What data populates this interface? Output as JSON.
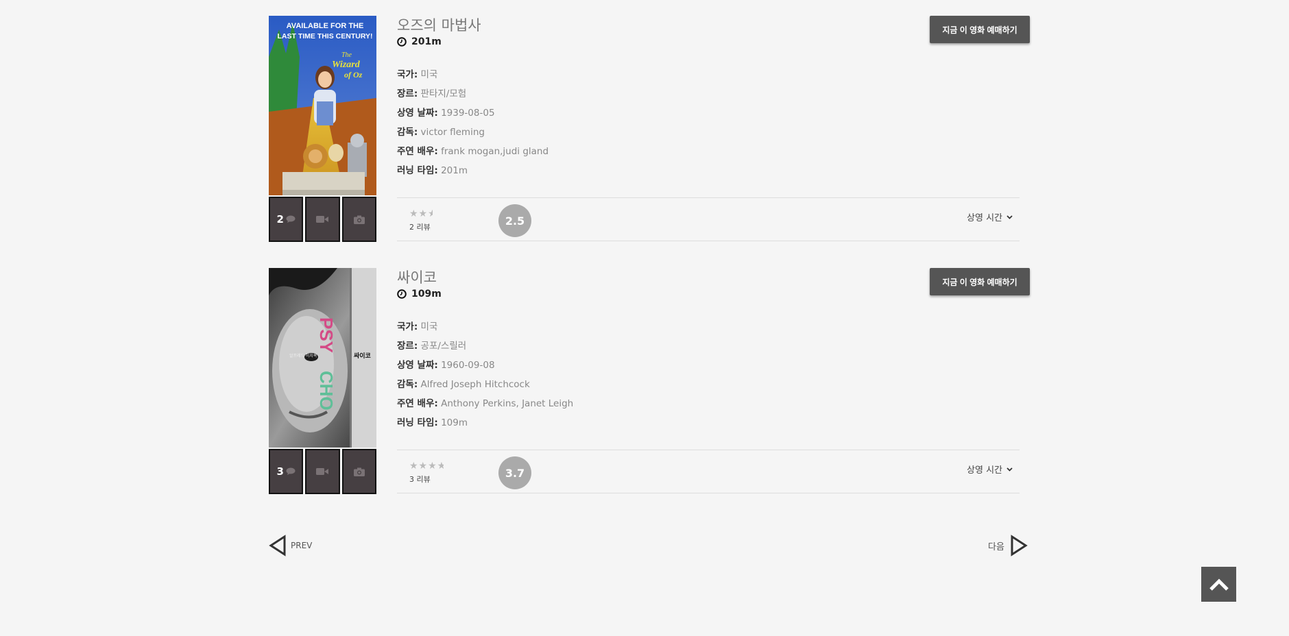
{
  "movies": [
    {
      "title": "오즈의 마법사",
      "runtime": "201m",
      "book_label": "지금 이 영화 예매하기",
      "details": [
        {
          "label": "국가:",
          "value": "미국"
        },
        {
          "label": "장르:",
          "value": "판타지/모험"
        },
        {
          "label": "상영 날짜:",
          "value": "1939-08-05"
        },
        {
          "label": "감독:",
          "value": "victor fleming"
        },
        {
          "label": "주연 배우:",
          "value": "frank mogan,judi gland"
        },
        {
          "label": "러닝 타임:",
          "value": "201m"
        }
      ],
      "comment_count": "2",
      "rating": 2.5,
      "score": "2.5",
      "reviews": "2 리뷰",
      "showtime_label": "상영 시간",
      "poster": {
        "headline_1": "AVAILABLE FOR THE",
        "headline_2": "LAST TIME THIS CENTURY!",
        "logo_1": "The",
        "logo_2": "Wizard",
        "logo_3": "of Oz"
      }
    },
    {
      "title": "싸이코",
      "runtime": "109m",
      "book_label": "지금 이 영화 예매하기",
      "details": [
        {
          "label": "국가:",
          "value": "미국"
        },
        {
          "label": "장르:",
          "value": "공포/스릴러"
        },
        {
          "label": "상영 날짜:",
          "value": "1960-09-08"
        },
        {
          "label": "감독:",
          "value": "Alfred Joseph Hitchcock"
        },
        {
          "label": "주연 배우:",
          "value": "Anthony Perkins, Janet Leigh"
        },
        {
          "label": "러닝 타임:",
          "value": "109m"
        }
      ],
      "comment_count": "3",
      "rating": 3.7,
      "score": "3.7",
      "reviews": "3 리뷰",
      "showtime_label": "상영 시간",
      "poster": {
        "word_pink": "PSY",
        "word_green": "CHO",
        "director_text": "알프레드 히치콕",
        "korean_title": "싸이코"
      }
    }
  ],
  "stars_glyphs": "★★★★★",
  "pager": {
    "prev_label": "PREV",
    "next_label": "다음"
  },
  "icons": {
    "clock": "clock-icon",
    "comment": "comment-icon",
    "video": "video-camera-icon",
    "camera": "camera-icon",
    "chevron": "chevron-down-icon",
    "prev": "triangle-left-icon",
    "next": "triangle-right-icon",
    "top": "chevron-up-icon"
  },
  "colors": {
    "page_bg": "#f5f5f5",
    "button_bg": "#555555",
    "thumb_bg": "#463f42",
    "score_bg": "#aaaaaa"
  }
}
